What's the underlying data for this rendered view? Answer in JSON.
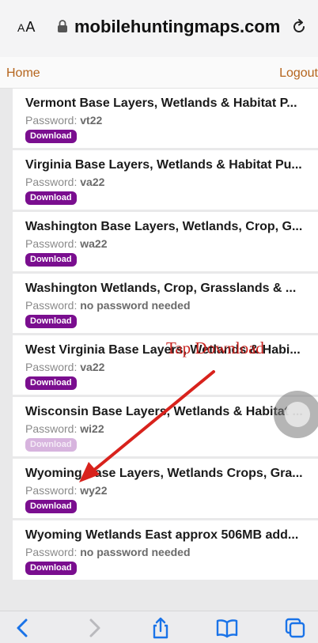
{
  "browser": {
    "aa_label_small": "A",
    "aa_label_large": "A",
    "url": "mobilehuntingmaps.com"
  },
  "nav": {
    "home": "Home",
    "logout": "Logout"
  },
  "password_label": "Password:",
  "download_label": "Download",
  "items": [
    {
      "title": "",
      "password": "",
      "pressed": false
    },
    {
      "title": "Vermont Base Layers, Wetlands & Habitat P...",
      "password": "vt22",
      "pressed": false
    },
    {
      "title": "Virginia Base Layers, Wetlands & Habitat Pu...",
      "password": "va22",
      "pressed": false
    },
    {
      "title": "Washington Base Layers, Wetlands, Crop, G...",
      "password": "wa22",
      "pressed": false
    },
    {
      "title": "Washington Wetlands, Crop, Grasslands & ...",
      "password": "no password needed",
      "pressed": false
    },
    {
      "title": "West Virginia Base Layers, Wetlands & Habi...",
      "password": "va22",
      "pressed": false
    },
    {
      "title": "Wisconsin Base Layers, Wetlands & Habitat ...",
      "password": "wi22",
      "pressed": true
    },
    {
      "title": "Wyoming Base Layers, Wetlands Crops, Gra...",
      "password": "wy22",
      "pressed": false
    },
    {
      "title": "Wyoming Wetlands East approx 506MB add...",
      "password": "no password needed",
      "pressed": false
    }
  ],
  "annotation": {
    "text": "Tap Download",
    "color": "#c8231f"
  },
  "colors": {
    "download_button": "#7a0e8f",
    "nav_link": "#b5651d"
  }
}
